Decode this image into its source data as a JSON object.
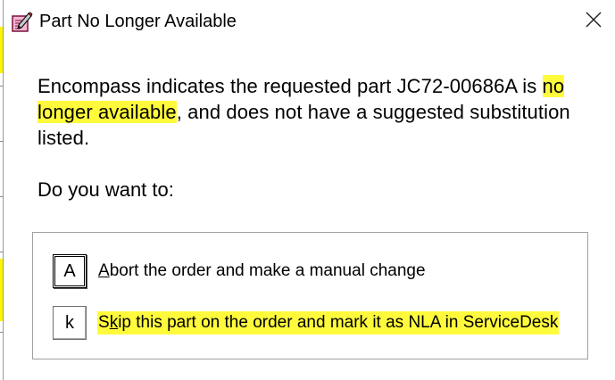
{
  "window": {
    "title": "Part No Longer Available",
    "icon": "pencil-notepad-icon",
    "close_icon": "close-icon"
  },
  "message": {
    "text_before": "Encompass indicates the requested part JC72-00686A is",
    "highlight": "no longer available",
    "text_after": ", and does not have a suggested substitution listed."
  },
  "question": "Do you want to:",
  "options": [
    {
      "key": "A",
      "label_access_char": "A",
      "label_rest": "bort the order and make a manual change",
      "highlighted": false
    },
    {
      "key": "k",
      "label_pre": "S",
      "label_access_char": "k",
      "label_rest": "ip this part on the order and mark it as NLA in ServiceDesk",
      "highlighted": true
    }
  ],
  "colors": {
    "highlight": "#fffb3c",
    "backdrop_yellow": "#fbf500",
    "border": "#a0a0a0"
  }
}
